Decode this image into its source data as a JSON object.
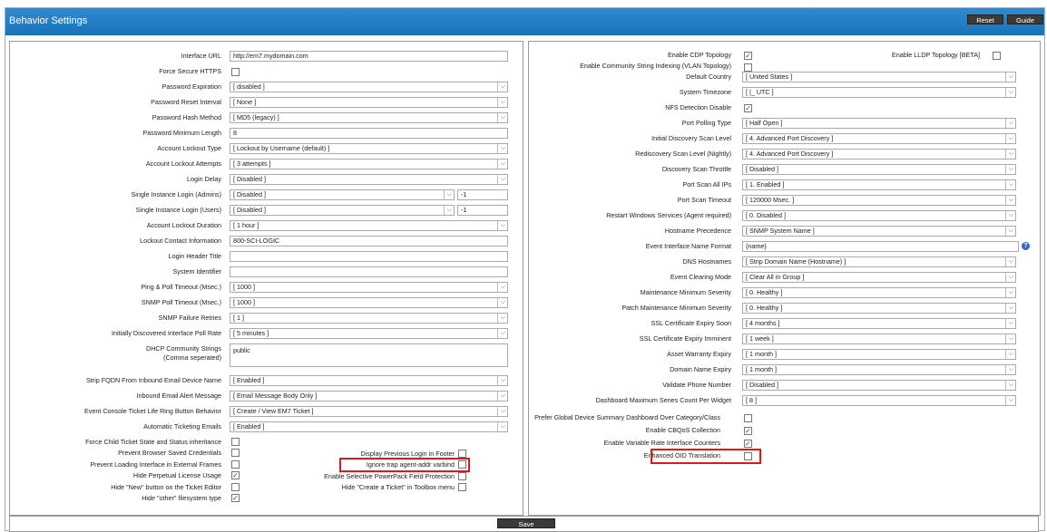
{
  "window": {
    "title": "Behavior Settings",
    "reset_label": "Reset",
    "guide_label": "Guide",
    "save_label": "Save"
  },
  "colors": {
    "titlebar": "#1a72b8",
    "highlight": "#e01818",
    "help": "#3563c9"
  },
  "left": {
    "interface_url": {
      "label": "Interface URL",
      "value": "http://em7.mydomain.com"
    },
    "force_https": {
      "label": "Force Secure HTTPS"
    },
    "password_expiration": {
      "label": "Password Expiration",
      "value": "[ disabled ]"
    },
    "password_reset_interval": {
      "label": "Password Reset Interval",
      "value": "[ None ]"
    },
    "password_hash_method": {
      "label": "Password Hash Method",
      "value": "[ MD5 (legacy) ]"
    },
    "password_min_length": {
      "label": "Password Minimum Length",
      "value": "8"
    },
    "account_lockout_type": {
      "label": "Account Lockout Type",
      "value": "[ Lockout by Username (default) ]"
    },
    "account_lockout_attempts": {
      "label": "Account Lockout Attempts",
      "value": "[ 3 attempts ]"
    },
    "login_delay": {
      "label": "Login Delay",
      "value": "[ Disabled ]"
    },
    "single_login_admins": {
      "label": "Single Instance Login (Admins)",
      "value": "[ Disabled ]",
      "extra": "-1"
    },
    "single_login_users": {
      "label": "Single Instance Login (Users)",
      "value": "[ Disabled ]",
      "extra": "-1"
    },
    "account_lockout_duration": {
      "label": "Account Lockout Duration",
      "value": "[ 1 hour ]"
    },
    "lockout_contact": {
      "label": "Lockout Contact Information",
      "value": "800-SCI-LOGIC"
    },
    "login_header_title": {
      "label": "Login Header Title",
      "value": ""
    },
    "system_identifier": {
      "label": "System Identifier",
      "value": ""
    },
    "ping_poll_timeout": {
      "label": "Ping & Poll Timeout (Msec.)",
      "value": "[ 1000 ]"
    },
    "snmp_poll_timeout": {
      "label": "SNMP Poll Timeout (Msec.)",
      "value": "[ 1000 ]"
    },
    "snmp_failure_retries": {
      "label": "SNMP Failure Retries",
      "value": "[ 1 ]"
    },
    "initial_poll_rate": {
      "label": "Initially Discovered Interface Poll Rate",
      "value": "[ 5 minutes ]"
    },
    "dhcp_strings": {
      "label1": "DHCP Community Strings",
      "label2": "(Comma seperated)",
      "value": "public"
    },
    "strip_fqdn": {
      "label": "Strip FQDN From Inbound Email Device Name",
      "value": "[ Enabled ]"
    },
    "inbound_email": {
      "label": "Inbound Email Alert Message",
      "value": "[ Email Message Body Only ]"
    },
    "ticket_ring": {
      "label": "Event Console Ticket Life Ring Button Behavior",
      "value": "[ Create / View EM7 Ticket ]"
    },
    "auto_ticketing": {
      "label": "Automatic Ticketing Emails",
      "value": "[ Enabled ]"
    },
    "checks": [
      {
        "label": "Force Child Ticket State and Status inheritance",
        "checked": false
      },
      {
        "label": "Prevent Browser Saved Credentials",
        "checked": false
      },
      {
        "label": "Prevent Loading Interface in External Frames",
        "checked": false
      },
      {
        "label": "Hide Perpetual License Usage",
        "checked": true
      },
      {
        "label": "Hide \"New\" button on the Ticket Editor",
        "checked": false
      },
      {
        "label": "Hide \"other\" filesystem type",
        "checked": true
      }
    ],
    "checks_mid": [
      {
        "label": "Display Previous Login in Footer",
        "checked": false
      },
      {
        "label": "Ignore trap agent-addr varbind",
        "checked": false
      },
      {
        "label": "Enable Selective PowerPack Field Protection",
        "checked": false
      },
      {
        "label": "Hide \"Create a Ticket\" in Toolbox menu",
        "checked": false
      }
    ]
  },
  "right": {
    "cdp": {
      "label": "Enable CDP Topology",
      "checked": true
    },
    "lldp": {
      "label": "Enable LLDP Topology [BETA]",
      "checked": false
    },
    "vlan": {
      "label": "Enable Community String Indexing (VLAN Topology)",
      "checked": false
    },
    "selects": [
      {
        "label": "Default Country",
        "value": "[ United States ]"
      },
      {
        "label": "System Timezone",
        "value": "[ |_ UTC ]"
      }
    ],
    "nfs": {
      "label": "NFS Detection Disable",
      "checked": true
    },
    "selects2": [
      {
        "label": "Port Polling Type",
        "value": "[ Half Open ]"
      },
      {
        "label": "Initial Discovery Scan Level",
        "value": "[ 4. Advanced Port Discovery ]"
      },
      {
        "label": "Rediscovery Scan Level (Nightly)",
        "value": "[ 4. Advanced Port Discovery ]"
      },
      {
        "label": "Discovery Scan Throttle",
        "value": "[ Disabled ]"
      },
      {
        "label": "Port Scan All IPs",
        "value": "[ 1. Enabled ]"
      },
      {
        "label": "Port Scan Timeout",
        "value": "[ 120000 Msec. ]"
      },
      {
        "label": "Restart Windows Services (Agent required)",
        "value": "[ 0. Disabled ]"
      },
      {
        "label": "Hostname Precedence",
        "value": "[ SNMP System Name ]"
      }
    ],
    "event_iface": {
      "label": "Event Interface Name Format",
      "value": "{name}"
    },
    "selects3": [
      {
        "label": "DNS Hostnames",
        "value": "[ Strip Domain Name (Hostname) ]"
      },
      {
        "label": "Event Clearing Mode",
        "value": "[ Clear All in Group ]"
      },
      {
        "label": "Maintenance Minimum Severity",
        "value": "[ 0. Healthy ]"
      },
      {
        "label": "Patch Maintenance Minimum Severity",
        "value": "[ 0. Healthy ]"
      },
      {
        "label": "SSL Certificate Expiry Soon",
        "value": "[ 4 months ]"
      },
      {
        "label": "SSL Certificate Expiry Imminent",
        "value": "[ 1 week ]"
      },
      {
        "label": "Asset Warranty Expiry",
        "value": "[ 1 month ]"
      },
      {
        "label": "Domain Name Expiry",
        "value": "[ 1 month ]"
      },
      {
        "label": "Validate Phone Number",
        "value": "[ Disabled ]"
      },
      {
        "label": "Dashboard Maximum Series Count Per Widget",
        "value": "[ 8 ]"
      }
    ],
    "checks": [
      {
        "label": "Prefer Global Device Summary Dashboard Over Category/Class",
        "checked": false
      },
      {
        "label": "Enable CBQoS Collection",
        "checked": true
      },
      {
        "label": "Enable Variable Rate Interface Counters",
        "checked": true
      },
      {
        "label": "Enhanced OID Translation",
        "checked": false
      }
    ]
  }
}
